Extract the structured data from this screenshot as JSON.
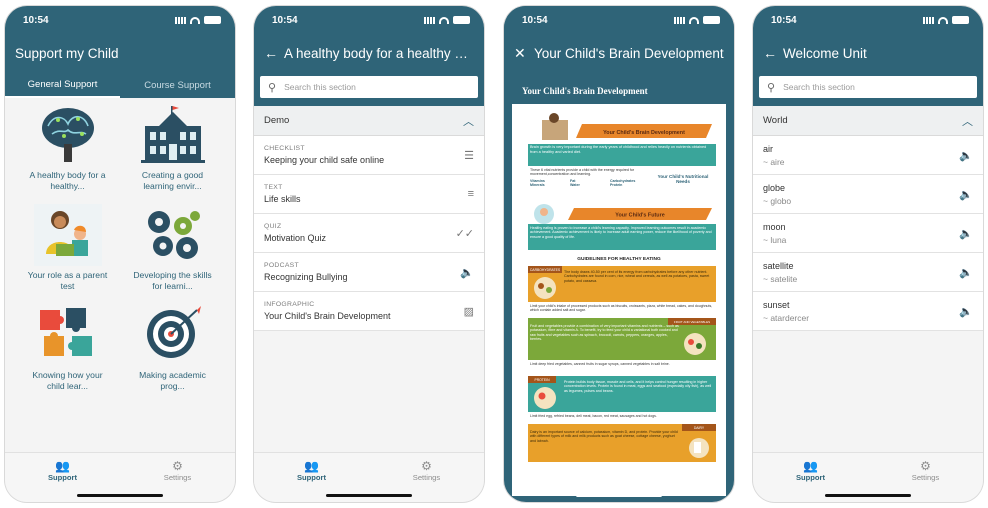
{
  "status": {
    "time": "10:54"
  },
  "screen1": {
    "title": "Support my Child",
    "tabs": [
      {
        "label": "General Support"
      },
      {
        "label": "Course Support"
      }
    ],
    "tiles": [
      {
        "label": "A healthy body for a healthy...",
        "icon": "brain-tree-icon"
      },
      {
        "label": "Creating a good learning envir...",
        "icon": "school-building-icon"
      },
      {
        "label": "Your role as a parent test",
        "icon": "parent-child-icon"
      },
      {
        "label": "Developing the skills for learni...",
        "icon": "gears-icon"
      },
      {
        "label": "Knowing how your child lear...",
        "icon": "puzzle-icon"
      },
      {
        "label": "Making academic prog...",
        "icon": "target-icon"
      }
    ]
  },
  "tabbar": {
    "support": "Support",
    "settings": "Settings"
  },
  "screen2": {
    "title": "A healthy body for a healthy mi...",
    "search_placeholder": "Search this section",
    "section": "Demo",
    "items": [
      {
        "kind": "CHECKLIST",
        "title": "Keeping your child safe online",
        "icon": "list-icon"
      },
      {
        "kind": "TEXT",
        "title": "Life skills",
        "icon": "text-lines-icon"
      },
      {
        "kind": "QUIZ",
        "title": "Motivation Quiz",
        "icon": "double-check-icon"
      },
      {
        "kind": "PODCAST",
        "title": "Recognizing Bullying",
        "icon": "speaker-icon"
      },
      {
        "kind": "INFOGRAPHIC",
        "title": "Your Child's Brain Development",
        "icon": "image-icon"
      }
    ]
  },
  "screen3": {
    "title": "Your Child's Brain Development",
    "doc_title": "Your Child's Brain Development",
    "banner1": "Your Child's Brain Development",
    "intro": "Brain growth is very important during the early years of childhood and relies heavily on nutrients obtained from a healthy and varied diet.",
    "nutrients_intro": "These 6 vital nutrients provide a child with the energy required for movement,concentration and learning.",
    "nutrients": [
      "Vitamins",
      "Fat",
      "Carbohydrates",
      "Minerals",
      "Water",
      "Protein"
    ],
    "nutritional_needs": "Your Child's Nutritional Needs",
    "banner2": "Your Child's Future",
    "future_text": "Healthy eating is proven to increase a child's learning capacity. Improved learning outcomes result in academic achievement. Academic achievement is likely to increase adult earning power, reduce the likelihood of poverty and ensure a good quality of life.",
    "guidelines": "GUIDELINES FOR HEALTHY EATING",
    "sections": [
      {
        "tag": "CARBOHYDRATES",
        "text": "The body draws 40-50 per cent of its energy from carbohydrates before any other nutrient. Carbohydrates are found in corn, rice, wheat and cereals, as well as potatoes, pasta, sweet potato, and cassava.",
        "limit": "Limit your child's intake of processed products such as biscuits, croissants, pizza, white bread, cakes, and doughnuts, which contain added salt and sugar."
      },
      {
        "tag": "FRUIT AND VEGETABLES",
        "text": "Fruit and vegetables provide a combination of very important vitamins and nutrients – such as potassium, fibre and vitamin A. To benefit, try to feed your child a variational both cooked and raw fruits and vegetables such as spinach, broccoli, carrots, peppers, oranges, apples, berries.",
        "limit": "Limit deep fried vegetables, canned fruits in sugar syrups, canned vegetables in salt brine."
      },
      {
        "tag": "PROTEIN",
        "text": "Protein builds body tissue, muscle and cells, and it helps control hunger resulting in higher concentration levels. Protein is found in meat, eggs and seafood (especially oily fish), as well as legumes, pulses and beans.",
        "limit": "Limit fried egg, refried beans, deli meat, bacon, red meat, sausages and hot dogs."
      },
      {
        "tag": "DAIRY",
        "text": "Dairy is an important source of calcium, potassium, vitamin D, and protein. Provide your child with different types of milk and milk products such as goat cheese, cottage cheese, yoghurt and labnah.",
        "limit": ""
      }
    ]
  },
  "screen4": {
    "title": "Welcome Unit",
    "search_placeholder": "Search this section",
    "section": "World",
    "words": [
      {
        "word": "air",
        "translation": "~ aire"
      },
      {
        "word": "globe",
        "translation": "~ globo"
      },
      {
        "word": "moon",
        "translation": "~ luna"
      },
      {
        "word": "satellite",
        "translation": "~ satelite"
      },
      {
        "word": "sunset",
        "translation": "~ atardercer"
      }
    ]
  },
  "colors": {
    "primary": "#2f6478",
    "teal": "#3aa59a",
    "orange": "#e98e2a",
    "green": "#7ca83a"
  }
}
